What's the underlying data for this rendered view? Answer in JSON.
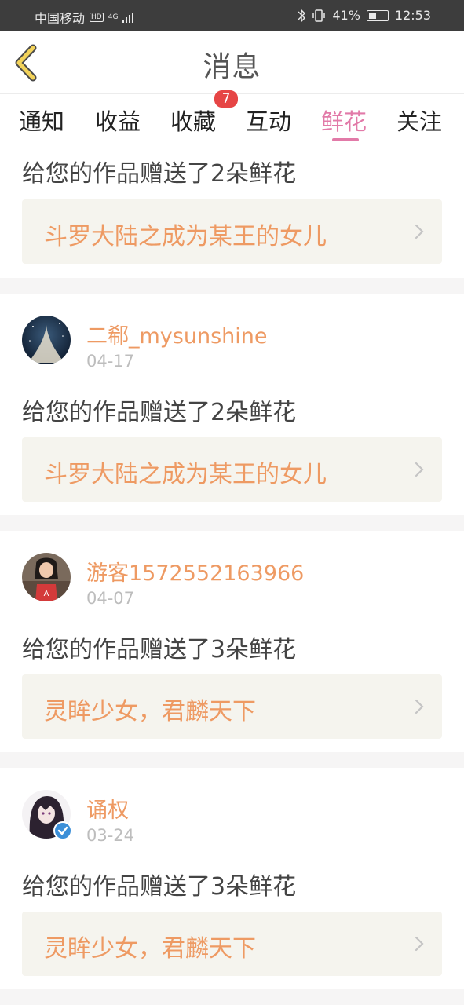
{
  "status_bar": {
    "carrier": "中国移动",
    "hd": "HD",
    "network": "4G",
    "battery": "41%",
    "time": "12:53"
  },
  "header": {
    "title": "消息"
  },
  "tabs": [
    {
      "label": "通知",
      "active": false
    },
    {
      "label": "收益",
      "active": false
    },
    {
      "label": "收藏",
      "active": false,
      "badge": "7"
    },
    {
      "label": "互动",
      "active": false
    },
    {
      "label": "鲜花",
      "active": true
    },
    {
      "label": "关注",
      "active": false
    }
  ],
  "colors": {
    "accent_pink": "#e27aa8",
    "name_orange": "#ee9a63",
    "badge_red": "#e64545"
  },
  "messages": [
    {
      "username": "",
      "date": "",
      "text": "给您的作品赠送了2朵鲜花",
      "work": "斗罗大陆之成为某王的女儿"
    },
    {
      "username": "二郗_mysunshine",
      "date": "04-17",
      "text": "给您的作品赠送了2朵鲜花",
      "work": "斗罗大陆之成为某王的女儿",
      "avatar": "night-sky-avatar"
    },
    {
      "username": "游客1572552163966",
      "date": "04-07",
      "text": "给您的作品赠送了3朵鲜花",
      "work": "灵眸少女，君麟天下",
      "avatar": "girl-photo-avatar"
    },
    {
      "username": "诵权",
      "date": "03-24",
      "text": "给您的作品赠送了3朵鲜花",
      "work": "灵眸少女，君麟天下",
      "avatar": "anime-avatar",
      "verified": true
    }
  ]
}
